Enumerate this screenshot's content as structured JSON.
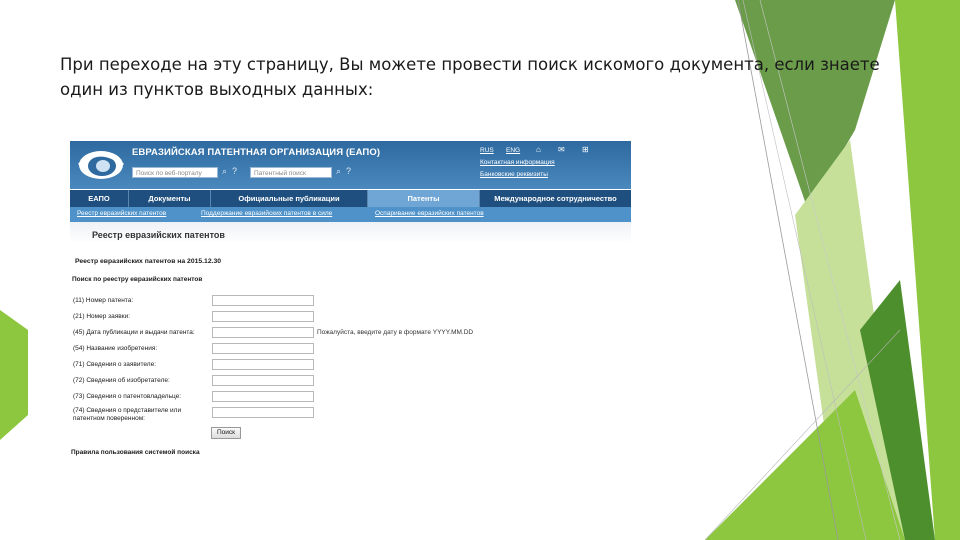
{
  "slide": {
    "text": "При переходе на эту страницу, Вы можете провести поиск искомого документа, если знаете один из пунктов выходных данных:"
  },
  "colors": {
    "accent_green": "#8dc63f",
    "dark_green": "#4e8f2d",
    "header_blue": "#2e6aa0",
    "nav_blue": "#1f4f7e"
  },
  "site": {
    "org_name": "ЕВРАЗИЙСКАЯ ПАТЕНТНАЯ ОРГАНИЗАЦИЯ (ЕАПО)",
    "search_portal_placeholder": "Поиск по веб-порталу",
    "patent_search_placeholder": "Патентный поиск",
    "lang_rus": "RUS",
    "lang_eng": "ENG",
    "contacts": "Контактная информация",
    "bank": "Банковские реквизиты",
    "icons": [
      "logo-icon",
      "search-icon",
      "help-icon",
      "home-icon",
      "mail-icon",
      "sitemap-icon"
    ]
  },
  "nav": {
    "items": [
      "ЕАПО",
      "Документы",
      "Официальные публикации",
      "Патенты",
      "Международное сотрудничество"
    ],
    "active": "Патенты"
  },
  "subnav": {
    "items": [
      "Реестр евразийских патентов",
      "Поддержание евразийских патентов в силе",
      "Оспаривание евразийских патентов"
    ]
  },
  "page": {
    "title": "Реестр евразийских патентов",
    "register_date": "Реестр евразийских патентов на 2015.12.30",
    "search_heading": "Поиск по реестру евразийских патентов",
    "fields": [
      {
        "label": "(11) Номер патента:",
        "value": ""
      },
      {
        "label": "(21) Номер заявки:",
        "value": ""
      },
      {
        "label": "(45) Дата публикации и выдачи патента:",
        "value": ""
      },
      {
        "label": "(54) Название изобретения:",
        "value": ""
      },
      {
        "label": "(71) Сведения о заявителе:",
        "value": ""
      },
      {
        "label": "(72) Сведения об изобретателе:",
        "value": ""
      },
      {
        "label": "(73) Сведения о патентовладельце:",
        "value": ""
      },
      {
        "label": "(74) Сведения о представителе или патентном поверенном:",
        "value": ""
      }
    ],
    "date_hint": "Пожалуйста, введите дату в формате YYYY.MM.DD",
    "search_button": "Поиск",
    "rules": "Правила пользования системой поиска"
  }
}
